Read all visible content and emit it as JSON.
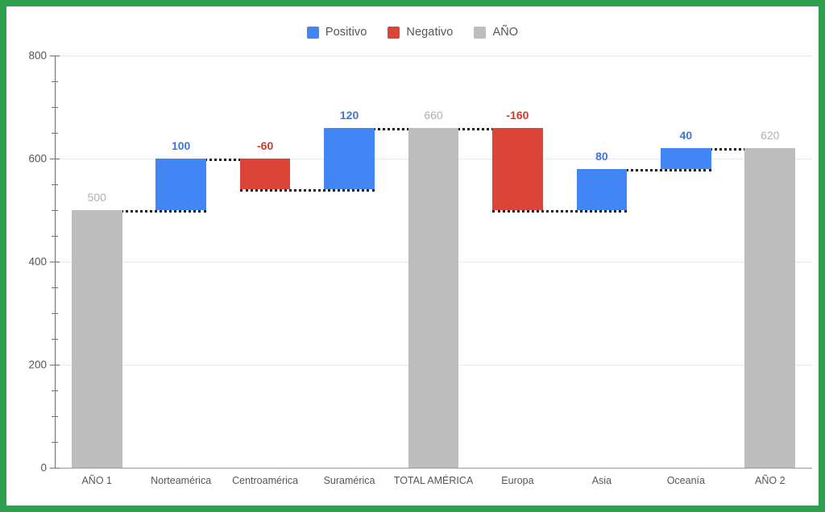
{
  "legend": {
    "items": [
      {
        "label": "Positivo",
        "color": "#4285f4",
        "icon": "legend-swatch-positivo"
      },
      {
        "label": "Negativo",
        "color": "#db4437",
        "icon": "legend-swatch-negativo"
      },
      {
        "label": "AÑO",
        "color": "#bdbdbd",
        "icon": "legend-swatch-ano"
      }
    ]
  },
  "chart_data": {
    "type": "bar",
    "subtype": "waterfall",
    "title": "",
    "xlabel": "",
    "ylabel": "",
    "ylim": [
      0,
      800
    ],
    "grid": true,
    "legend_position": "top-center",
    "y_ticks_major": [
      0,
      200,
      400,
      600,
      800
    ],
    "y_ticks_minor": [
      50,
      100,
      150,
      250,
      300,
      350,
      450,
      500,
      550,
      650,
      700,
      750
    ],
    "categories": [
      "AÑO 1",
      "Norteamérica",
      "Centroamérica",
      "Suramérica",
      "TOTAL AMÉRICA",
      "Europa",
      "Asia",
      "Oceanía",
      "AÑO 2"
    ],
    "colors": {
      "positive": "#4285f4",
      "negative": "#db4437",
      "total": "#bdbdbd",
      "connector": "#1a1a1a",
      "label_positive": "#3f76d4",
      "label_negative": "#cc3b2e",
      "label_total": "#b0b0b0"
    },
    "bars": [
      {
        "category": "AÑO 1",
        "kind": "total",
        "label": "500",
        "value": 500,
        "base": 0,
        "top": 500
      },
      {
        "category": "Norteamérica",
        "kind": "positive",
        "label": "100",
        "value": 100,
        "base": 500,
        "top": 600
      },
      {
        "category": "Centroamérica",
        "kind": "negative",
        "label": "-60",
        "value": -60,
        "base": 600,
        "top": 540
      },
      {
        "category": "Suramérica",
        "kind": "positive",
        "label": "120",
        "value": 120,
        "base": 540,
        "top": 660
      },
      {
        "category": "TOTAL AMÉRICA",
        "kind": "total",
        "label": "660",
        "value": 660,
        "base": 0,
        "top": 660
      },
      {
        "category": "Europa",
        "kind": "negative",
        "label": "-160",
        "value": -160,
        "base": 660,
        "top": 500
      },
      {
        "category": "Asia",
        "kind": "positive",
        "label": "80",
        "value": 80,
        "base": 500,
        "top": 580
      },
      {
        "category": "Oceanía",
        "kind": "positive",
        "label": "40",
        "value": 40,
        "base": 580,
        "top": 620
      },
      {
        "category": "AÑO 2",
        "kind": "total",
        "label": "620",
        "value": 620,
        "base": 0,
        "top": 620
      }
    ],
    "connectors": [
      {
        "from": "AÑO 1",
        "to": "Norteamérica",
        "level": 500
      },
      {
        "from": "Norteamérica",
        "to": "Centroamérica",
        "level": 600
      },
      {
        "from": "Centroamérica",
        "to": "Suramérica",
        "level": 540
      },
      {
        "from": "Suramérica",
        "to": "TOTAL AMÉRICA",
        "level": 660
      },
      {
        "from": "TOTAL AMÉRICA",
        "to": "Europa",
        "level": 660
      },
      {
        "from": "Europa",
        "to": "Asia",
        "level": 500
      },
      {
        "from": "Asia",
        "to": "Oceanía",
        "level": 580
      },
      {
        "from": "Oceanía",
        "to": "AÑO 2",
        "level": 620
      }
    ]
  }
}
